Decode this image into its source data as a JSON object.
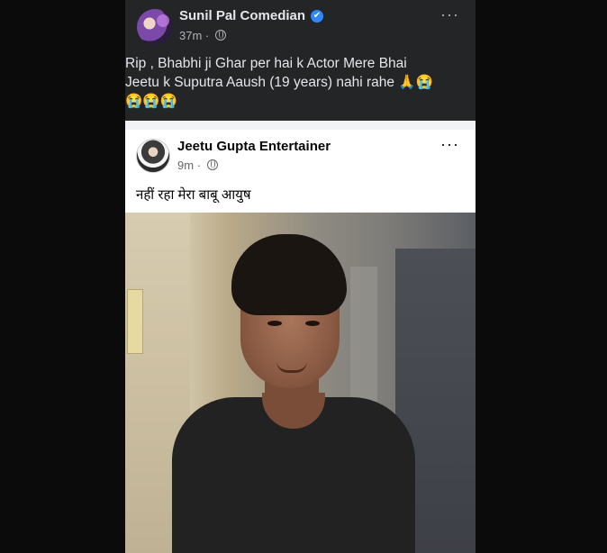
{
  "outer_post": {
    "author": "Sunil Pal Comedian",
    "verified_symbol": "✔",
    "time": "37m",
    "separator": "·",
    "more": "···",
    "text_line1": "Rip , Bhabhi ji Ghar per hai k Actor Mere Bhai",
    "text_line2": "Jeetu k Suputra Aaush (19 years) nahi rahe 🙏😭",
    "text_line3": "😭😭😭"
  },
  "shared_post": {
    "author": "Jeetu Gupta Entertainer",
    "time": "9m",
    "separator": "·",
    "more": "···",
    "text": "नहीं रहा मेरा बाबू आयुष"
  },
  "icons": [
    "verified-badge-icon",
    "globe-icon",
    "more-options-icon"
  ],
  "colors": {
    "dark_card": "#242526",
    "verified": "#2d88ff",
    "text_dark_theme": "#e4e6eb",
    "text_light_theme": "#050505"
  }
}
